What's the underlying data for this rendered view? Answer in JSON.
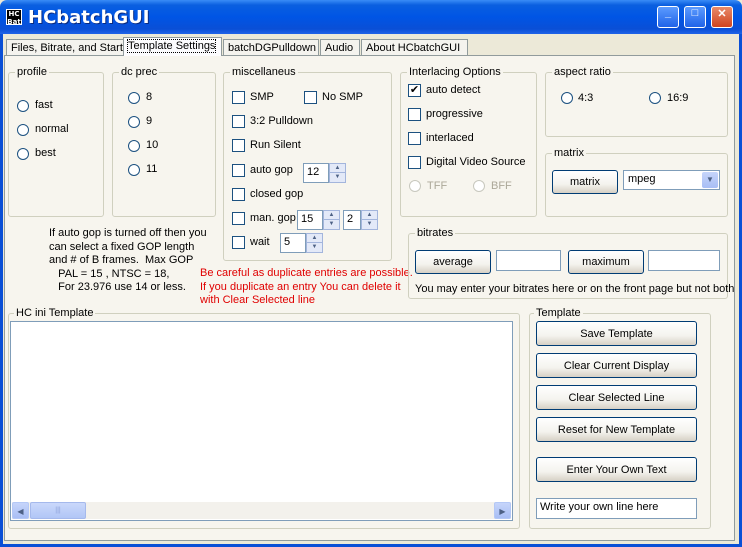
{
  "window": {
    "title": "HCbatchGUI",
    "icon_text": "HC\nBat",
    "buttons": [
      "minimize",
      "maximize",
      "close"
    ]
  },
  "tabs": [
    {
      "label": "Files, Bitrate, and Start"
    },
    {
      "label": "Template Settings",
      "active": true
    },
    {
      "label": "batchDGPulldown"
    },
    {
      "label": "Audio"
    },
    {
      "label": "About HCbatchGUI"
    }
  ],
  "profile": {
    "title": "profile",
    "options": [
      "fast",
      "normal",
      "best"
    ]
  },
  "dc_prec": {
    "title": "dc prec",
    "options": [
      "8",
      "9",
      "10",
      "11"
    ]
  },
  "misc": {
    "title": "miscellaneus",
    "smp": "SMP",
    "no_smp": "No SMP",
    "pulldown": "3:2 Pulldown",
    "run_silent": "Run Silent",
    "auto_gop": "auto gop",
    "auto_gop_value": "12",
    "closed_gop": "closed gop",
    "man_gop": "man. gop",
    "man_gop_value1": "15",
    "man_gop_value2": "2",
    "wait": "wait",
    "wait_value": "5"
  },
  "interlacing": {
    "title": "Interlacing Options",
    "auto_detect": "auto detect",
    "auto_detect_checked": true,
    "progressive": "progressive",
    "interlaced": "interlaced",
    "dvs": "Digital Video Source",
    "tff": "TFF",
    "bff": "BFF"
  },
  "aspect": {
    "title": "aspect ratio",
    "opt1": "4:3",
    "opt2": "16:9"
  },
  "matrix": {
    "title": "matrix",
    "button": "matrix",
    "selected": "mpeg"
  },
  "bitrates": {
    "title": "bitrates",
    "average": "average",
    "maximum": "maximum",
    "average_value": "",
    "maximum_value": "",
    "note": "You may enter your bitrates here or on the front page but not both"
  },
  "gop_note": "If auto gop is turned off then you\ncan select a fixed GOP length\nand # of B frames.  Max GOP\n   PAL = 15 , NTSC = 18,\n   For 23.976 use 14 or less.",
  "warning": "Be careful as duplicate entries are possible.\nIf you duplicate an entry You can delete it\nwith Clear Selected line",
  "ini": {
    "title": "HC ini Template",
    "content": ""
  },
  "template": {
    "title": "Template",
    "save": "Save Template",
    "clear_display": "Clear Current Display",
    "clear_line": "Clear Selected Line",
    "reset": "Reset for New Template",
    "enter_text": "Enter Your Own Text",
    "own_line": "Write your own line here"
  },
  "icons": {
    "scroll_left": "◀",
    "scroll_right": "▶",
    "thumb_grip": "|||",
    "dropdown": "▼",
    "spin_up": "▲",
    "spin_down": "▼",
    "check": "✔",
    "minimize": "_",
    "maximize": "□",
    "close": "✕"
  }
}
